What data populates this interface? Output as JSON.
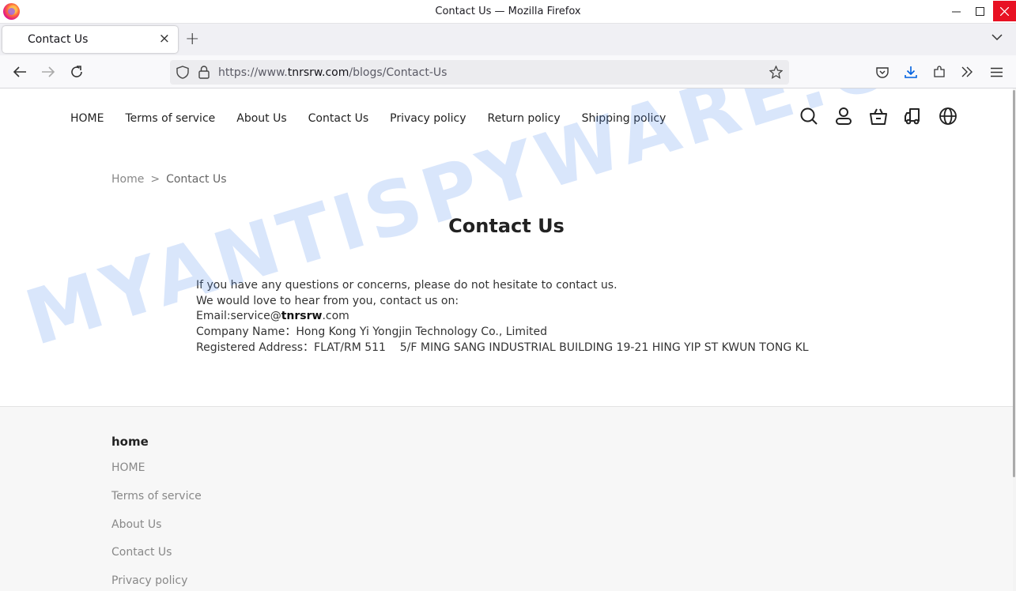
{
  "window": {
    "title": "Contact Us — Mozilla Firefox"
  },
  "tab": {
    "label": "Contact Us"
  },
  "url": {
    "prefix": "https://www.",
    "domain": "tnrsrw.com",
    "path": "/blogs/Contact-Us"
  },
  "site_nav": [
    "HOME",
    "Terms of service",
    "About Us",
    "Contact Us",
    "Privacy policy",
    "Return policy",
    "Shipping policy"
  ],
  "breadcrumb": {
    "home": "Home",
    "separator": ">",
    "current": "Contact Us"
  },
  "page_title": "Contact Us",
  "body": {
    "line1": "If you have any questions or concerns, please do not hesitate to contact us.",
    "line2": "We would love to hear from you, contact us on:",
    "email_label": "Email:service@",
    "email_domain": "tnrsrw",
    "email_tld": ".com",
    "company": "Company Name：Hong Kong Yi Yongjin Technology Co., Limited",
    "address": "Registered Address：FLAT/RM 511    5/F MING SANG INDUSTRIAL BUILDING 19-21 HING YIP ST KWUN TONG KL"
  },
  "footer": {
    "heading": "home",
    "links": [
      "HOME",
      "Terms of service",
      "About Us",
      "Contact Us",
      "Privacy policy"
    ]
  },
  "watermark": "MYANTISPYWARE.COM",
  "colors": {
    "close_button": "#e81123",
    "accent": "#0061e0"
  }
}
